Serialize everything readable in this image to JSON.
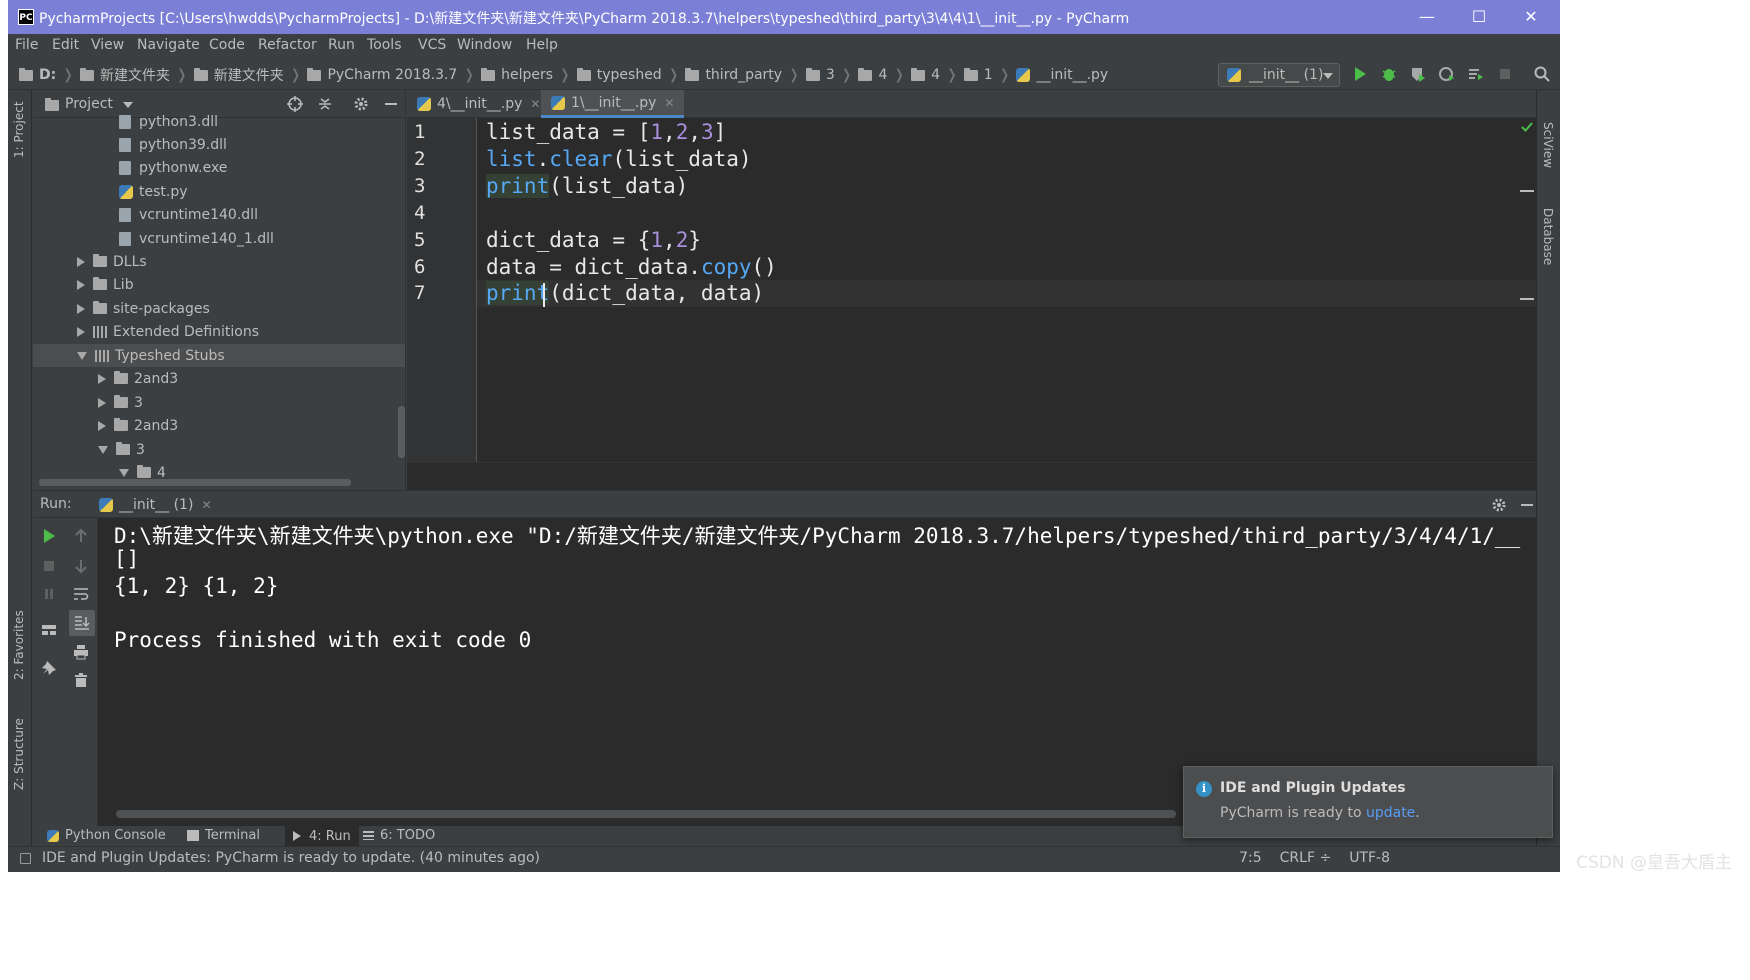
{
  "window": {
    "title": "PycharmProjects [C:\\Users\\hwdds\\PycharmProjects] - D:\\新建文件夹\\新建文件夹\\PyCharm 2018.3.7\\helpers\\typeshed\\third_party\\3\\4\\4\\1\\__init__.py - PyCharm",
    "logo": "PC"
  },
  "menu": [
    "File",
    "Edit",
    "View",
    "Navigate",
    "Code",
    "Refactor",
    "Run",
    "Tools",
    "VCS",
    "Window",
    "Help"
  ],
  "breadcrumbs": [
    "D:",
    "新建文件夹",
    "新建文件夹",
    "PyCharm 2018.3.7",
    "helpers",
    "typeshed",
    "third_party",
    "3",
    "4",
    "4",
    "1",
    "__init__.py"
  ],
  "run_config": "__init__ (1)",
  "left_tools": {
    "project": "1: Project",
    "favorites": "2: Favorites",
    "structure": "Z: Structure"
  },
  "right_tools": {
    "sciview": "SciView",
    "database": "Database"
  },
  "project_panel": {
    "title": "Project",
    "rows": [
      {
        "label": "python3.dll",
        "kind": "file"
      },
      {
        "label": "python39.dll",
        "kind": "file"
      },
      {
        "label": "pythonw.exe",
        "kind": "file"
      },
      {
        "label": "test.py",
        "kind": "py"
      },
      {
        "label": "vcruntime140.dll",
        "kind": "file"
      },
      {
        "label": "vcruntime140_1.dll",
        "kind": "file"
      },
      {
        "label": "DLLs",
        "kind": "folder"
      },
      {
        "label": "Lib",
        "kind": "folder"
      },
      {
        "label": "site-packages",
        "kind": "folder"
      },
      {
        "label": "Extended Definitions",
        "kind": "lib"
      },
      {
        "label": "Typeshed Stubs",
        "kind": "lib"
      },
      {
        "label": "2and3",
        "kind": "folder"
      },
      {
        "label": "3",
        "kind": "folder"
      },
      {
        "label": "2and3",
        "kind": "folder"
      },
      {
        "label": "3",
        "kind": "folder"
      },
      {
        "label": "4",
        "kind": "folder"
      }
    ]
  },
  "editor_tabs": [
    {
      "label": "4\\__init__.py",
      "active": false
    },
    {
      "label": "1\\__init__.py",
      "active": true
    }
  ],
  "code_lines": [
    {
      "num": "1",
      "text": "list_data = [1,2,3]"
    },
    {
      "num": "2",
      "text": "list.clear(list_data)"
    },
    {
      "num": "3",
      "text": "print(list_data)"
    },
    {
      "num": "4",
      "text": ""
    },
    {
      "num": "5",
      "text": "dict_data = {1,2}"
    },
    {
      "num": "6",
      "text": "data = dict_data.copy()"
    },
    {
      "num": "7",
      "text": "print(dict_data, data)"
    }
  ],
  "run_panel": {
    "label": "Run:",
    "tab": "__init__ (1)",
    "output": [
      "D:\\新建文件夹\\新建文件夹\\python.exe \"D:/新建文件夹/新建文件夹/PyCharm 2018.3.7/helpers/typeshed/third_party/3/4/4/1/__",
      "[]",
      "{1, 2} {1, 2}",
      "",
      "Process finished with exit code 0"
    ]
  },
  "bottom_tabs": [
    "Python Console",
    "Terminal",
    "4: Run",
    "6: TODO"
  ],
  "notification": {
    "title": "IDE and Plugin Updates",
    "body_prefix": "PyCharm is ready to ",
    "link": "update",
    "body_suffix": "."
  },
  "status": {
    "message": "IDE and Plugin Updates: PyCharm is ready to update. (40 minutes ago)",
    "position": "7:5",
    "line_sep": "CRLF ÷",
    "encoding": "UTF-8"
  },
  "watermark": "CSDN @皇吾大盾主",
  "colors": {
    "title_bar": "#7b7fd6",
    "panel_bg": "#3c3f41",
    "editor_bg": "#2b2b2b",
    "keyword_blue": "#56a8f5",
    "number_purple": "#a98fdb",
    "link_blue": "#589df6",
    "run_green": "#4dbd4a"
  }
}
